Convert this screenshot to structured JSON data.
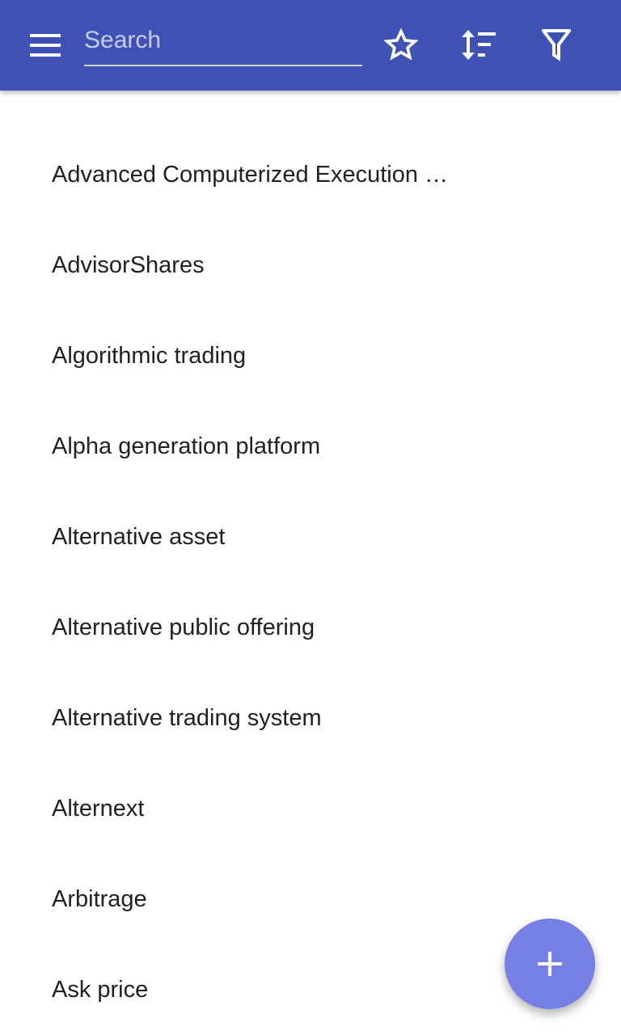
{
  "colors": {
    "toolbar": "#3f51b5",
    "fab": "#7580e5",
    "text": "#212121"
  },
  "toolbar": {
    "menu_icon": "menu-icon",
    "search_placeholder": "Search",
    "search_value": "",
    "star_icon": "star-outline-icon",
    "sort_icon": "sort-icon",
    "filter_icon": "filter-icon"
  },
  "terms": [
    {
      "label": "Advanced Computerized Execution …"
    },
    {
      "label": "AdvisorShares"
    },
    {
      "label": "Algorithmic trading"
    },
    {
      "label": "Alpha generation platform"
    },
    {
      "label": "Alternative asset"
    },
    {
      "label": "Alternative public offering"
    },
    {
      "label": "Alternative trading system"
    },
    {
      "label": "Alternext"
    },
    {
      "label": "Arbitrage"
    },
    {
      "label": "Ask price"
    }
  ],
  "fab": {
    "icon": "plus-icon"
  }
}
